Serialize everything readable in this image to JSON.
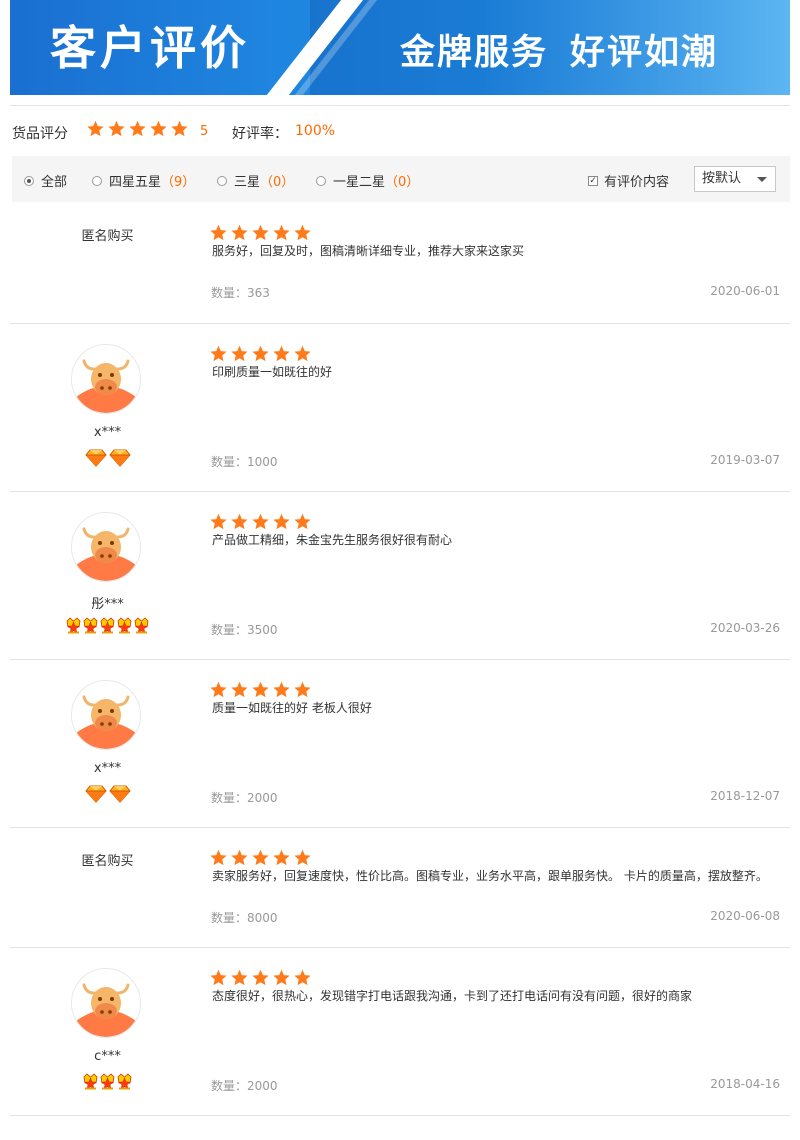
{
  "banner": {
    "left_title": "客户评价",
    "right_title_a": "金牌服务",
    "right_title_b": "好评如潮"
  },
  "summary": {
    "score_label": "货品评分",
    "score_stars": 5,
    "score_value": "5",
    "rate_label": "好评率：",
    "rate_value": "100%"
  },
  "filters": {
    "radios": [
      {
        "label": "全部",
        "count": "",
        "selected": true
      },
      {
        "label": "四星五星",
        "count": "（9）",
        "selected": false
      },
      {
        "label": "三星",
        "count": "（0）",
        "selected": false
      },
      {
        "label": "一星二星",
        "count": "（0）",
        "selected": false
      }
    ],
    "has_content_label": "有评价内容",
    "has_content_checked": true,
    "sort_selected": "按默认"
  },
  "colors": {
    "star": "#ff7a1a",
    "accent": "#ff6a00",
    "muted": "#999999"
  },
  "qty_prefix": "数量：",
  "reviews": [
    {
      "anonymous": true,
      "anon_label": "匿名购买",
      "username": "",
      "badge_type": "",
      "badge_count": 0,
      "stars": 5,
      "content": "服务好，回复及时，图稿清晰详细专业，推荐大家来这家买",
      "quantity": "363",
      "date": "2020-06-01"
    },
    {
      "anonymous": false,
      "anon_label": "",
      "username": "x***",
      "badge_type": "diamond",
      "badge_count": 2,
      "stars": 5,
      "content": "印刷质量一如既往的好",
      "quantity": "1000",
      "date": "2019-03-07"
    },
    {
      "anonymous": false,
      "anon_label": "",
      "username": "彤***",
      "badge_type": "crown",
      "badge_count": 5,
      "stars": 5,
      "content": "产品做工精细，朱金宝先生服务很好很有耐心",
      "quantity": "3500",
      "date": "2020-03-26"
    },
    {
      "anonymous": false,
      "anon_label": "",
      "username": "x***",
      "badge_type": "diamond",
      "badge_count": 2,
      "stars": 5,
      "content": "质量一如既往的好 老板人很好",
      "quantity": "2000",
      "date": "2018-12-07"
    },
    {
      "anonymous": true,
      "anon_label": "匿名购买",
      "username": "",
      "badge_type": "",
      "badge_count": 0,
      "stars": 5,
      "content": "卖家服务好，回复速度快，性价比高。图稿专业，业务水平高，跟单服务快。 卡片的质量高，摆放整齐。",
      "quantity": "8000",
      "date": "2020-06-08"
    },
    {
      "anonymous": false,
      "anon_label": "",
      "username": "c***",
      "badge_type": "crown",
      "badge_count": 3,
      "stars": 5,
      "content": "态度很好，很热心，发现错字打电话跟我沟通，卡到了还打电话问有没有问题，很好的商家",
      "quantity": "2000",
      "date": "2018-04-16"
    }
  ]
}
